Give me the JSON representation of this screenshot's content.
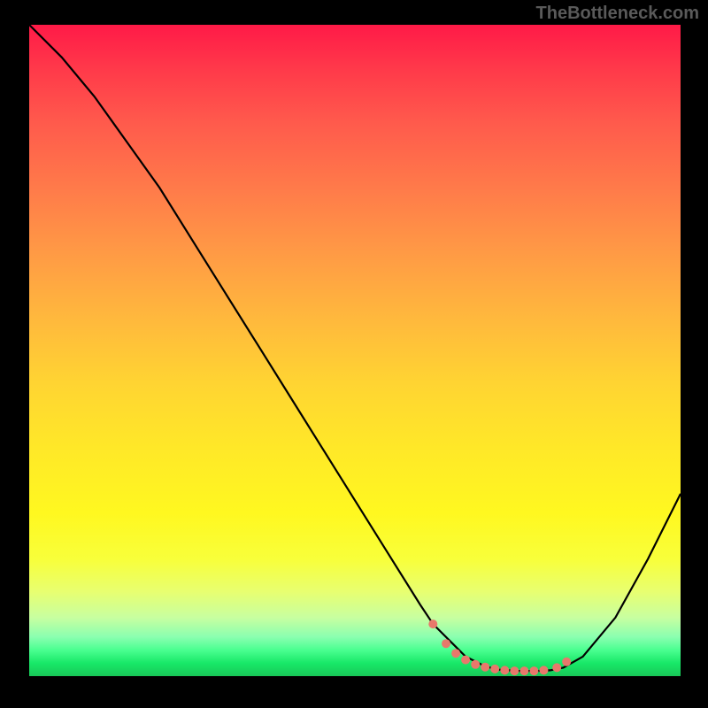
{
  "watermark": "TheBottleneck.com",
  "chart_data": {
    "type": "line",
    "title": "",
    "xlabel": "",
    "ylabel": "",
    "xlim": [
      0,
      100
    ],
    "ylim": [
      0,
      100
    ],
    "series": [
      {
        "name": "curve",
        "x": [
          0,
          5,
          10,
          15,
          20,
          25,
          30,
          35,
          40,
          45,
          50,
          55,
          60,
          62,
          65,
          67,
          70,
          72,
          75,
          78,
          80,
          82,
          85,
          90,
          95,
          100
        ],
        "y": [
          100,
          95,
          89,
          82,
          75,
          67,
          59,
          51,
          43,
          35,
          27,
          19,
          11,
          8,
          5,
          3,
          1.5,
          1.0,
          0.8,
          0.8,
          0.9,
          1.3,
          3,
          9,
          18,
          28
        ]
      }
    ],
    "highlight_points": {
      "name": "bottom-dots",
      "x": [
        62,
        64,
        65.5,
        67,
        68.5,
        70,
        71.5,
        73,
        74.5,
        76,
        77.5,
        79,
        81,
        82.5
      ],
      "y": [
        8,
        5,
        3.5,
        2.5,
        1.8,
        1.4,
        1.1,
        0.9,
        0.8,
        0.8,
        0.8,
        0.9,
        1.3,
        2.2
      ]
    },
    "background": {
      "type": "vertical-gradient",
      "stops": [
        {
          "pos": 0,
          "color": "#ff1a47"
        },
        {
          "pos": 50,
          "color": "#ffd432"
        },
        {
          "pos": 85,
          "color": "#f0ff60"
        },
        {
          "pos": 100,
          "color": "#18c858"
        }
      ]
    }
  }
}
